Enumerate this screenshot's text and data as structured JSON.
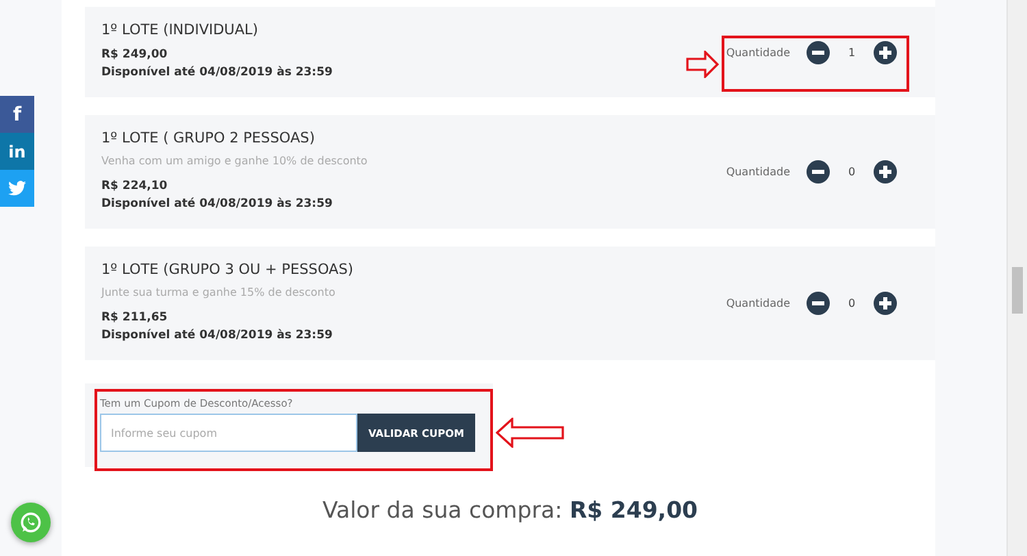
{
  "social": [
    {
      "kind": "facebook",
      "label": "f",
      "color": "#3b5998"
    },
    {
      "kind": "linkedin",
      "label": "in",
      "color": "#0e76a8"
    },
    {
      "kind": "twitter",
      "color": "#1da1f2"
    }
  ],
  "lots": [
    {
      "title": "1º LOTE (INDIVIDUAL)",
      "price": "R$ 249,00",
      "available": "Disponível até 04/08/2019 às 23:59",
      "quantity_label": "Quantidade",
      "quantity": "1",
      "highlighted": true
    },
    {
      "title": "1º LOTE ( GRUPO 2 PESSOAS)",
      "description": "Venha com um amigo e ganhe 10% de desconto",
      "price": "R$ 224,10",
      "available": "Disponível até 04/08/2019 às 23:59",
      "quantity_label": "Quantidade",
      "quantity": "0",
      "highlighted": false
    },
    {
      "title": "1º LOTE (GRUPO 3 OU + PESSOAS)",
      "description": "Junte sua turma e ganhe 15% de desconto",
      "price": "R$ 211,65",
      "available": "Disponível até 04/08/2019 às 23:59",
      "quantity_label": "Quantidade",
      "quantity": "0",
      "highlighted": false
    }
  ],
  "coupon": {
    "label": "Tem um Cupom de Desconto/Acesso?",
    "placeholder": "Informe seu cupom",
    "button": "VALIDAR CUPOM",
    "highlighted": true
  },
  "total": "Valor da sua compra: **R$ 249,00**"
}
